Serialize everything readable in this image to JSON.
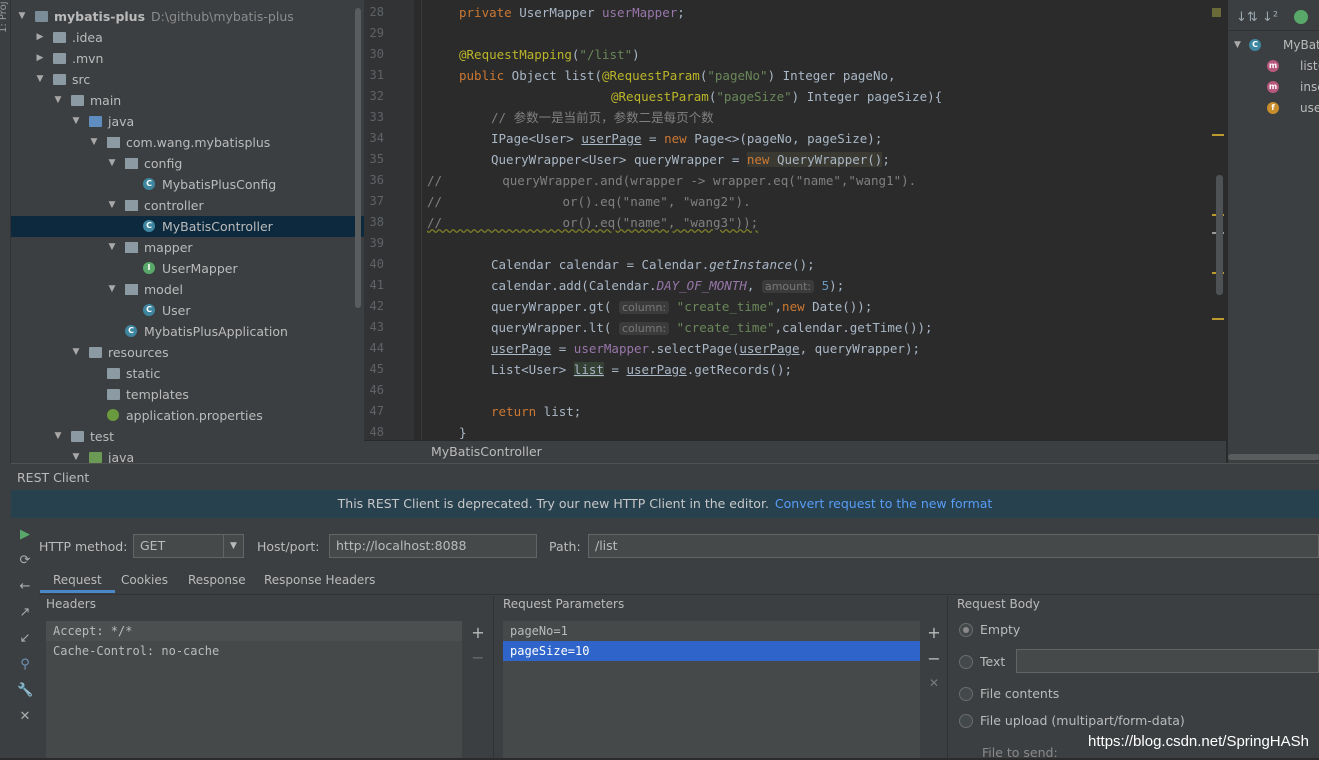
{
  "side_strip": {
    "label": "1: Proj"
  },
  "tree": [
    {
      "indent": 0,
      "arrow": "▼",
      "icon": "module",
      "label": "mybatis-plus",
      "extra": "D:\\github\\mybatis-plus",
      "bold": true
    },
    {
      "indent": 1,
      "arrow": "▶",
      "icon": "folder",
      "label": ".idea"
    },
    {
      "indent": 1,
      "arrow": "▶",
      "icon": "folder",
      "label": ".mvn"
    },
    {
      "indent": 1,
      "arrow": "▼",
      "icon": "folder",
      "label": "src"
    },
    {
      "indent": 2,
      "arrow": "▼",
      "icon": "folder",
      "label": "main"
    },
    {
      "indent": 3,
      "arrow": "▼",
      "icon": "folder-blue",
      "label": "java"
    },
    {
      "indent": 4,
      "arrow": "▼",
      "icon": "package",
      "label": "com.wang.mybatisplus"
    },
    {
      "indent": 5,
      "arrow": "▼",
      "icon": "package",
      "label": "config"
    },
    {
      "indent": 6,
      "arrow": "",
      "icon": "class",
      "label": "MybatisPlusConfig"
    },
    {
      "indent": 5,
      "arrow": "▼",
      "icon": "package",
      "label": "controller"
    },
    {
      "indent": 6,
      "arrow": "",
      "icon": "class",
      "label": "MyBatisController",
      "selected": true
    },
    {
      "indent": 5,
      "arrow": "▼",
      "icon": "package",
      "label": "mapper"
    },
    {
      "indent": 6,
      "arrow": "",
      "icon": "interface",
      "label": "UserMapper"
    },
    {
      "indent": 5,
      "arrow": "▼",
      "icon": "package",
      "label": "model"
    },
    {
      "indent": 6,
      "arrow": "",
      "icon": "class",
      "label": "User"
    },
    {
      "indent": 5,
      "arrow": "",
      "icon": "class",
      "label": "MybatisPlusApplication"
    },
    {
      "indent": 3,
      "arrow": "▼",
      "icon": "folder-res",
      "label": "resources"
    },
    {
      "indent": 4,
      "arrow": "",
      "icon": "folder",
      "label": "static"
    },
    {
      "indent": 4,
      "arrow": "",
      "icon": "folder",
      "label": "templates"
    },
    {
      "indent": 4,
      "arrow": "",
      "icon": "properties",
      "label": "application.properties"
    },
    {
      "indent": 2,
      "arrow": "▼",
      "icon": "folder",
      "label": "test"
    },
    {
      "indent": 3,
      "arrow": "▼",
      "icon": "folder-green",
      "label": "java"
    }
  ],
  "editor": {
    "line_numbers": [
      "28",
      "29",
      "30",
      "31",
      "32",
      "33",
      "34",
      "35",
      "36",
      "37",
      "38",
      "39",
      "40",
      "41",
      "42",
      "43",
      "44",
      "45",
      "46",
      "47",
      "48"
    ],
    "tab_label": "MyBatisController"
  },
  "structure": {
    "items": [
      {
        "label": "MyBat",
        "icon": "class"
      },
      {
        "label": "list(",
        "icon": "method"
      },
      {
        "label": "inse",
        "icon": "method"
      },
      {
        "label": "user",
        "icon": "field"
      }
    ]
  },
  "rest": {
    "title": "REST Client",
    "banner_text": "This REST Client is deprecated. Try our new HTTP Client in the editor.",
    "banner_link": "Convert request to the new format",
    "http_method_label": "HTTP method:",
    "http_method_value": "GET",
    "host_label": "Host/port:",
    "host_value": "http://localhost:8088",
    "path_label": "Path:",
    "path_value": "/list",
    "tabs": [
      "Request",
      "Cookies",
      "Response",
      "Response Headers"
    ],
    "headers_title": "Headers",
    "headers": [
      "Accept: */*",
      "Cache-Control: no-cache"
    ],
    "params_title": "Request Parameters",
    "params": [
      "pageNo=1",
      "pageSize=10"
    ],
    "body_title": "Request Body",
    "body_options": [
      "Empty",
      "Text",
      "File contents",
      "File upload (multipart/form-data)"
    ],
    "file_to_send": "File to send:"
  },
  "watermark": "https://blog.csdn.net/SpringHASh",
  "colors": {
    "accent": "#4a88c7",
    "selection": "#2f65ca",
    "banner_bg": "#28414f",
    "link": "#589df6"
  }
}
